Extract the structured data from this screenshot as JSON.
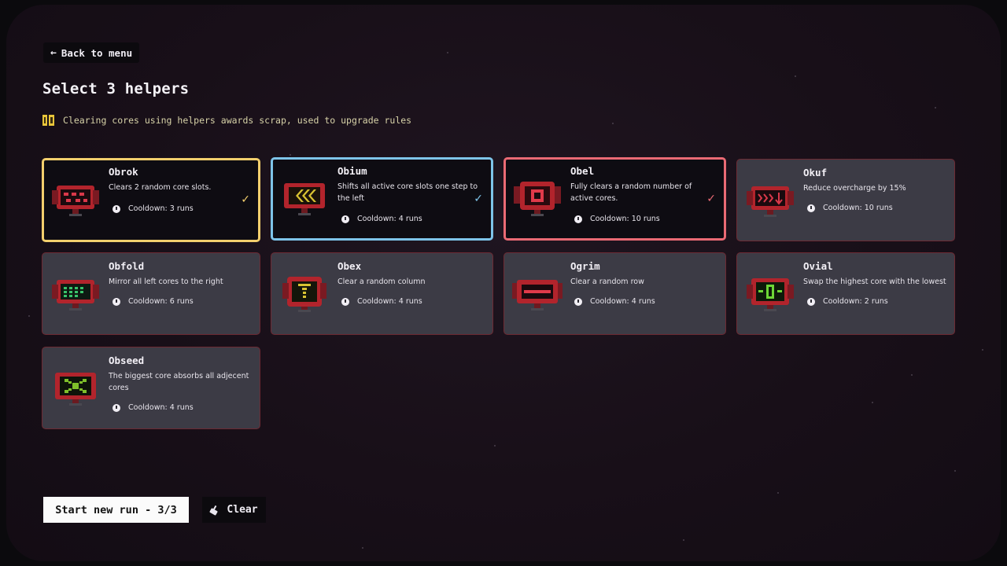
{
  "back_button": {
    "label": "Back to menu"
  },
  "title": "Select 3 helpers",
  "hint": {
    "icon": "scrap-icon",
    "text": "Clearing cores using helpers awards scrap, used to upgrade rules"
  },
  "colors": {
    "yellow": "#f3cf6d",
    "blue": "#7ec4e9",
    "red": "#ea6a74",
    "card": "#3c3b45"
  },
  "helpers": [
    {
      "name": "Obrok",
      "description": "Clears 2 random core slots.",
      "cooldown": "Cooldown: 3 runs",
      "selected": true,
      "check": "✓",
      "highlight": "yellow"
    },
    {
      "name": "Obium",
      "description": "Shifts all active core slots one step to the left",
      "cooldown": "Cooldown: 4 runs",
      "selected": true,
      "check": "✓",
      "highlight": "blue"
    },
    {
      "name": "Obel",
      "description": "Fully clears a random number of active cores.",
      "cooldown": "Cooldown: 10 runs",
      "selected": true,
      "check": "✓",
      "highlight": "red"
    },
    {
      "name": "Okuf",
      "description": "Reduce overcharge by 15%",
      "cooldown": "Cooldown: 10 runs",
      "selected": false
    },
    {
      "name": "Obfold",
      "description": "Mirror all left cores to the right",
      "cooldown": "Cooldown: 6 runs",
      "selected": false
    },
    {
      "name": "Obex",
      "description": "Clear a random column",
      "cooldown": "Cooldown: 4 runs",
      "selected": false
    },
    {
      "name": "Ogrim",
      "description": "Clear a random row",
      "cooldown": "Cooldown: 4 runs",
      "selected": false
    },
    {
      "name": "Ovial",
      "description": "Swap the highest core with the lowest",
      "cooldown": "Cooldown: 2 runs",
      "selected": false
    },
    {
      "name": "Obseed",
      "description": "The biggest core absorbs all adjecent cores",
      "cooldown": "Cooldown: 4 runs",
      "selected": false
    }
  ],
  "footer": {
    "start_label": "Start new run - 3/3",
    "clear_label": "Clear"
  }
}
